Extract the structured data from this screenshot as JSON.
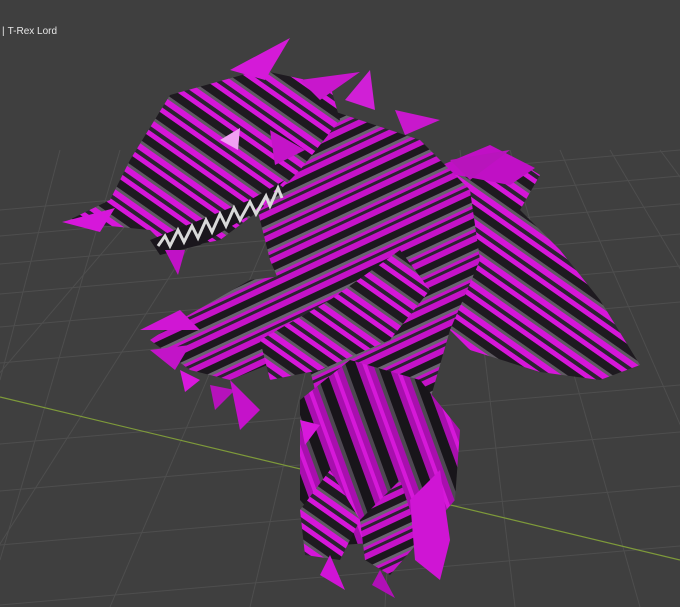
{
  "viewport": {
    "overlay": {
      "separator": "|",
      "object_name": "T-Rex Lord"
    }
  },
  "colors": {
    "background": "#3f3f3f",
    "grid_line": "#4e4e4e",
    "x_axis": "#7e9a3a",
    "model_magenta": "#d616d9",
    "model_dark": "#1e1a20",
    "model_gray": "#5f5a62",
    "teeth": "#d9d9d9"
  }
}
